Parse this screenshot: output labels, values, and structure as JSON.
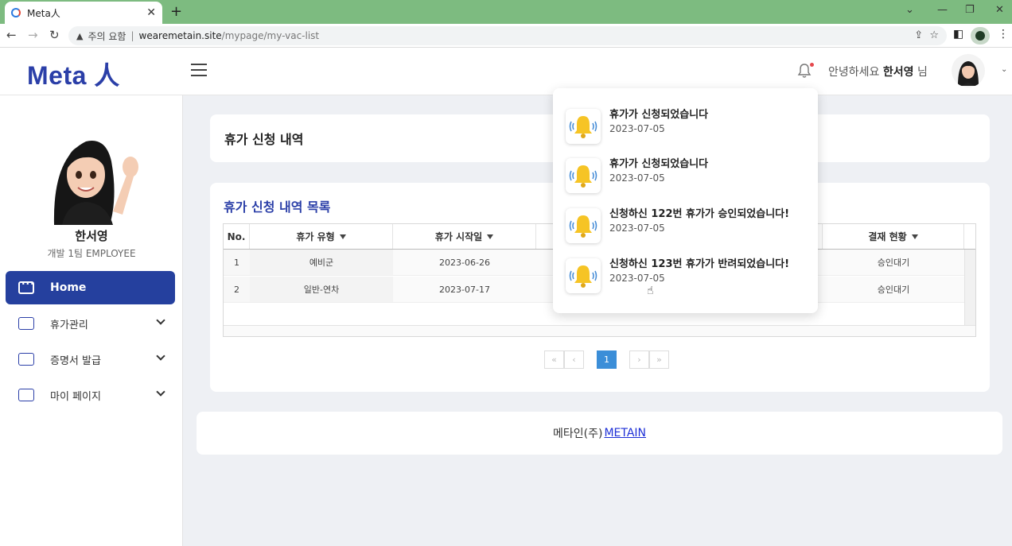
{
  "browser": {
    "tab_title": "Meta人",
    "tab_close": "✕",
    "new_tab": "+",
    "security_label": "주의 요함",
    "url_host": "wearemetain.site",
    "url_path": "/mypage/my-vac-list",
    "window_controls": [
      "⌄",
      "—",
      "❐",
      "✕"
    ]
  },
  "header": {
    "logo": "Meta 人",
    "greeting_prefix": "안녕하세요 ",
    "user_name": "한서영",
    "greeting_suffix": " 님"
  },
  "sidebar": {
    "name": "한서영",
    "role": "개발 1팀 EMPLOYEE",
    "items": [
      {
        "label": "Home"
      },
      {
        "label": "휴가관리"
      },
      {
        "label": "증명서 발급"
      },
      {
        "label": "마이 페이지"
      }
    ]
  },
  "page": {
    "title": "휴가 신청 내역",
    "list_title": "휴가 신청 내역 목록",
    "columns": [
      "No.",
      "휴가 유형",
      "휴가 시작일",
      "결재 현황"
    ],
    "rows": [
      {
        "no": "1",
        "type": "예비군",
        "start": "2023-06-26",
        "status": "승인대기"
      },
      {
        "no": "2",
        "type": "일반-연차",
        "start": "2023-07-17",
        "status": "승인대기"
      }
    ],
    "pager": {
      "first": "«",
      "prev": "‹",
      "current": "1",
      "next": "›",
      "last": "»"
    }
  },
  "footer": {
    "company": "메타인(주)",
    "link": "METAIN"
  },
  "notifications": [
    {
      "title": "휴가가 신청되었습니다",
      "date": "2023-07-05"
    },
    {
      "title": "휴가가 신청되었습니다",
      "date": "2023-07-05"
    },
    {
      "title": "신청하신 122번 휴가가 승인되었습니다!",
      "date": "2023-07-05"
    },
    {
      "title": "신청하신 123번 휴가가 반려되었습니다!",
      "date": "2023-07-05"
    }
  ],
  "colors": {
    "brand": "#2b3fa8",
    "sidebar_active": "#25409e",
    "pager_active": "#3b8ed8",
    "tabbar": "#7dbb80"
  },
  "icons": [
    "bell-icon",
    "hamburger-icon",
    "menu-icon",
    "chevron-down-icon",
    "filter-icon",
    "bell-notification-icon"
  ]
}
